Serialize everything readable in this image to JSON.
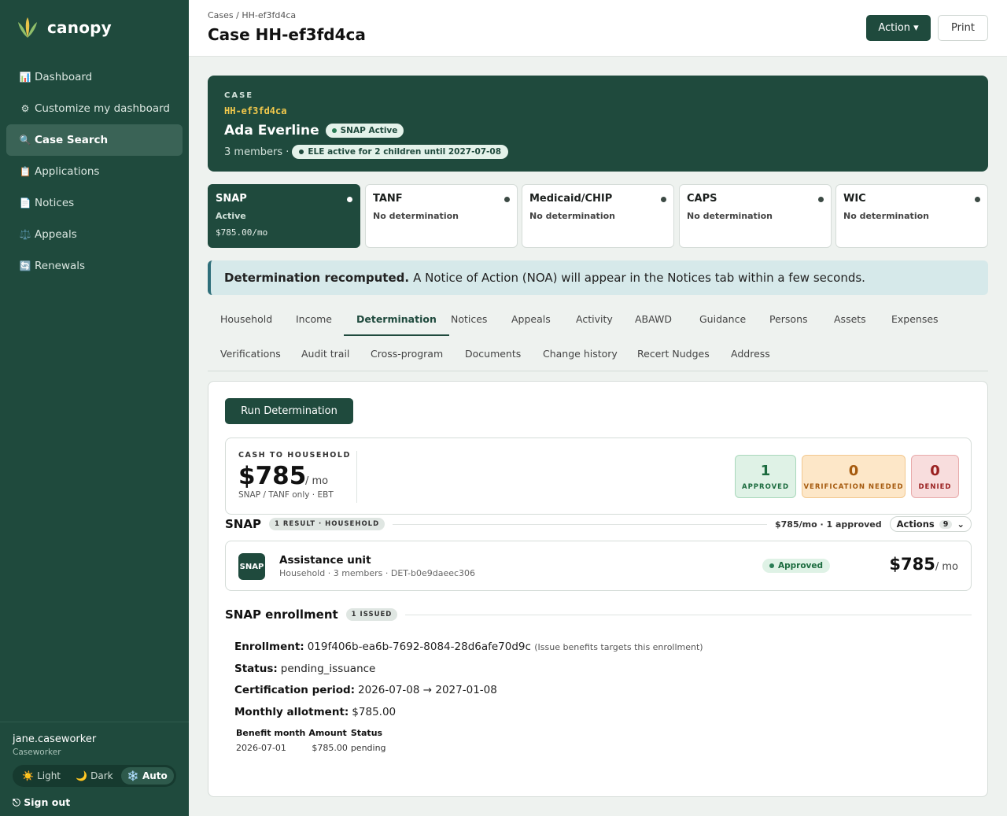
{
  "brand": {
    "name": "canopy"
  },
  "sidebar": {
    "items": [
      {
        "icon": "📊",
        "label": "Dashboard",
        "active": false
      },
      {
        "icon": "⚙",
        "label": "Customize my dashboard",
        "active": false
      },
      {
        "icon": "🔍",
        "label": "Case Search",
        "active": true
      },
      {
        "icon": "📋",
        "label": "Applications",
        "active": false
      },
      {
        "icon": "📄",
        "label": "Notices",
        "active": false
      },
      {
        "icon": "⚖️",
        "label": "Appeals",
        "active": false
      },
      {
        "icon": "🔄",
        "label": "Renewals",
        "active": false
      }
    ],
    "user": {
      "name": "jane.caseworker",
      "role": "Caseworker"
    },
    "theme": {
      "light": "☀️ Light",
      "dark": "🌙 Dark",
      "auto": "❄️ Auto",
      "selected": "auto"
    },
    "signout": "⎋ Sign out"
  },
  "header": {
    "breadcrumb": "Cases / HH-ef3fd4ca",
    "title": "Case HH-ef3fd4ca",
    "action_label": "Action ▾",
    "print_label": "Print"
  },
  "case": {
    "label": "CASE",
    "id": "HH-ef3fd4ca",
    "name": "Ada Everline",
    "status_pill": "SNAP Active",
    "members": "3 members ·",
    "ele_pill": "ELE active for 2 children until 2027-07-08"
  },
  "programs": [
    {
      "name": "SNAP",
      "status": "Active",
      "amount": "$785.00/mo",
      "active": true
    },
    {
      "name": "TANF",
      "status": "No determination",
      "amount": "",
      "active": false
    },
    {
      "name": "Medicaid/CHIP",
      "status": "No determination",
      "amount": "",
      "active": false
    },
    {
      "name": "CAPS",
      "status": "No determination",
      "amount": "",
      "active": false
    },
    {
      "name": "WIC",
      "status": "No determination",
      "amount": "",
      "active": false
    }
  ],
  "alert": {
    "title": "Determination recomputed.",
    "text": "A Notice of Action (NOA) will appear in the Notices tab within a few seconds."
  },
  "tabs": {
    "row1": [
      "Household",
      "Income",
      "Determination",
      "Notices",
      "Appeals",
      "Activity",
      "ABAWD",
      "Guidance",
      "Persons",
      "Assets",
      "Expenses"
    ],
    "row2": [
      "Verifications",
      "Audit trail",
      "Cross-program",
      "Documents",
      "Change history",
      "Recert Nudges",
      "Address"
    ],
    "active": "Determination"
  },
  "determination": {
    "run_label": "Run Determination",
    "summary": {
      "label": "CASH TO HOUSEHOLD",
      "amount": "$785",
      "per": "/ mo",
      "sub": "SNAP / TANF only · EBT",
      "approved": {
        "count": "1",
        "label": "APPROVED"
      },
      "verification": {
        "count": "0",
        "label": "VERIFICATION NEEDED"
      },
      "denied": {
        "count": "0",
        "label": "DENIED"
      }
    },
    "snap": {
      "title": "SNAP",
      "badge": "1 RESULT · HOUSEHOLD",
      "meta": "$785/mo · 1 approved",
      "actions_label": "Actions",
      "actions_count": "9",
      "unit": {
        "icon_text": "SNAP",
        "title": "Assistance unit",
        "sub": "Household · 3 members · DET-b0e9daeec306",
        "status": "Approved",
        "amount": "$785",
        "per": "/ mo"
      }
    },
    "enrollment": {
      "title": "SNAP enrollment",
      "badge": "1 ISSUED",
      "enrollment_label": "Enrollment:",
      "enrollment_value": "019f406b-ea6b-7692-8084-28d6afe70d9c",
      "enrollment_note": "(Issue benefits targets this enrollment)",
      "status_label": "Status:",
      "status_value": "pending_issuance",
      "cert_label": "Certification period:",
      "cert_value": "2026-07-08 → 2027-01-08",
      "allot_label": "Monthly allotment:",
      "allot_value": "$785.00",
      "table": {
        "headers": [
          "Benefit month",
          "Amount",
          "Status"
        ],
        "rows": [
          [
            "2026-07-01",
            "$785.00",
            "pending"
          ]
        ]
      }
    }
  }
}
